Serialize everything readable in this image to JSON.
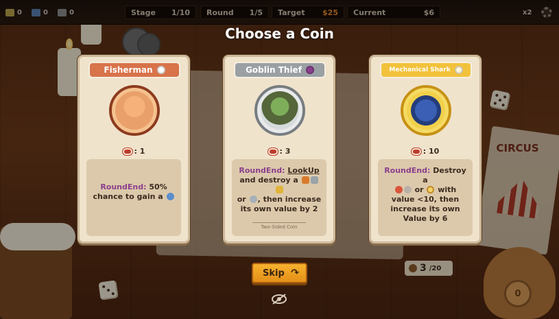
{
  "hud": {
    "resources": [
      "0",
      "0",
      "0"
    ],
    "stage_label": "Stage",
    "stage_value": "1/10",
    "round_label": "Round",
    "round_value": "1/5",
    "target_label": "Target",
    "target_value": "$25",
    "current_label": "Current",
    "current_value": "$6",
    "speed": "x2"
  },
  "title": "Choose a Coin",
  "cards": [
    {
      "name": "Fisherman",
      "value": ": 1",
      "round_end": "RoundEnd:",
      "desc": "50% chance to gain a",
      "colors": {
        "tag": "#d8734a",
        "ring": "#8c3b1e",
        "portrait": "#e9a06a"
      }
    },
    {
      "name": "Goblin Thief",
      "value": ": 3",
      "round_end": "RoundEnd:",
      "keyword": "LookUp",
      "desc_a": "and destroy a",
      "desc_b": "or",
      "desc_c": ", then increase its own value by 2",
      "subnote": "Two-Sided Coin",
      "colors": {
        "tag": "#9aa0a3",
        "ring": "#777d81",
        "portrait": "#d7dadb"
      }
    },
    {
      "name": "Mechanical Shark",
      "value": ": 10",
      "round_end": "RoundEnd:",
      "desc_a": "Destroy a",
      "desc_b": "or",
      "desc_c": "with value <10, then increase its own Value by 6",
      "colors": {
        "tag": "#f2c23b",
        "ring": "#c69115",
        "portrait": "#f1d04b"
      }
    }
  ],
  "skip_label": "Skip",
  "bag_counter": {
    "count": "3",
    "total": "/20"
  },
  "bag_coin_value": "0",
  "poster_text": "CIRCUS"
}
